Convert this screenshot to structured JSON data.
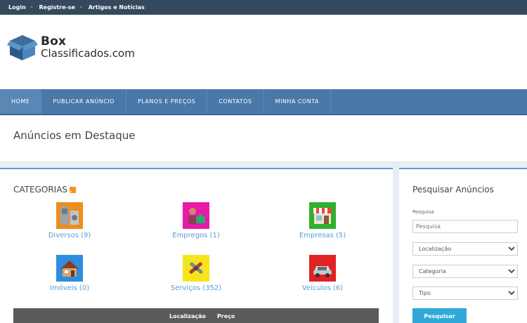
{
  "topbar": {
    "login": "Login",
    "register": "Registre-se",
    "articles": "Artigos e Notícias"
  },
  "logo": {
    "line1": "Box",
    "line2": "Classificados.com"
  },
  "nav": {
    "items": [
      "HOME",
      "PUBLICAR ANÚNCIO",
      "PLANOS E PREÇOS",
      "CONTATOS",
      "MINHA CONTA"
    ]
  },
  "page": {
    "title": "Anúncios em Destaque"
  },
  "categories": {
    "heading": "CATEGORIAS",
    "items": [
      {
        "label": "Diversos (9)",
        "icon": "appliances-icon",
        "color": "#f08c1a"
      },
      {
        "label": "Empregos (1)",
        "icon": "worker-icon",
        "color": "#e81aa9"
      },
      {
        "label": "Empresas (5)",
        "icon": "storefront-icon",
        "color": "#2fb02f"
      },
      {
        "label": "Imóveis (0)",
        "icon": "house-icon",
        "color": "#2d8de0"
      },
      {
        "label": "Serviços (352)",
        "icon": "tools-icon",
        "color": "#f4e61a"
      },
      {
        "label": "Veículos (6)",
        "icon": "car-icon",
        "color": "#e02222"
      }
    ]
  },
  "table": {
    "col_location": "Localização",
    "col_price": "Preço"
  },
  "search": {
    "heading": "Pesquisar Anúncios",
    "label": "Pesquisa",
    "placeholder": "Pesquisa",
    "location": "Localização",
    "category": "Categoria",
    "type": "Tipo",
    "button": "Pesquisar"
  },
  "colors": {
    "nav": "#4a78a8",
    "accent": "#5b9bd5",
    "button": "#2fa8d8",
    "topbar": "#34495e"
  }
}
